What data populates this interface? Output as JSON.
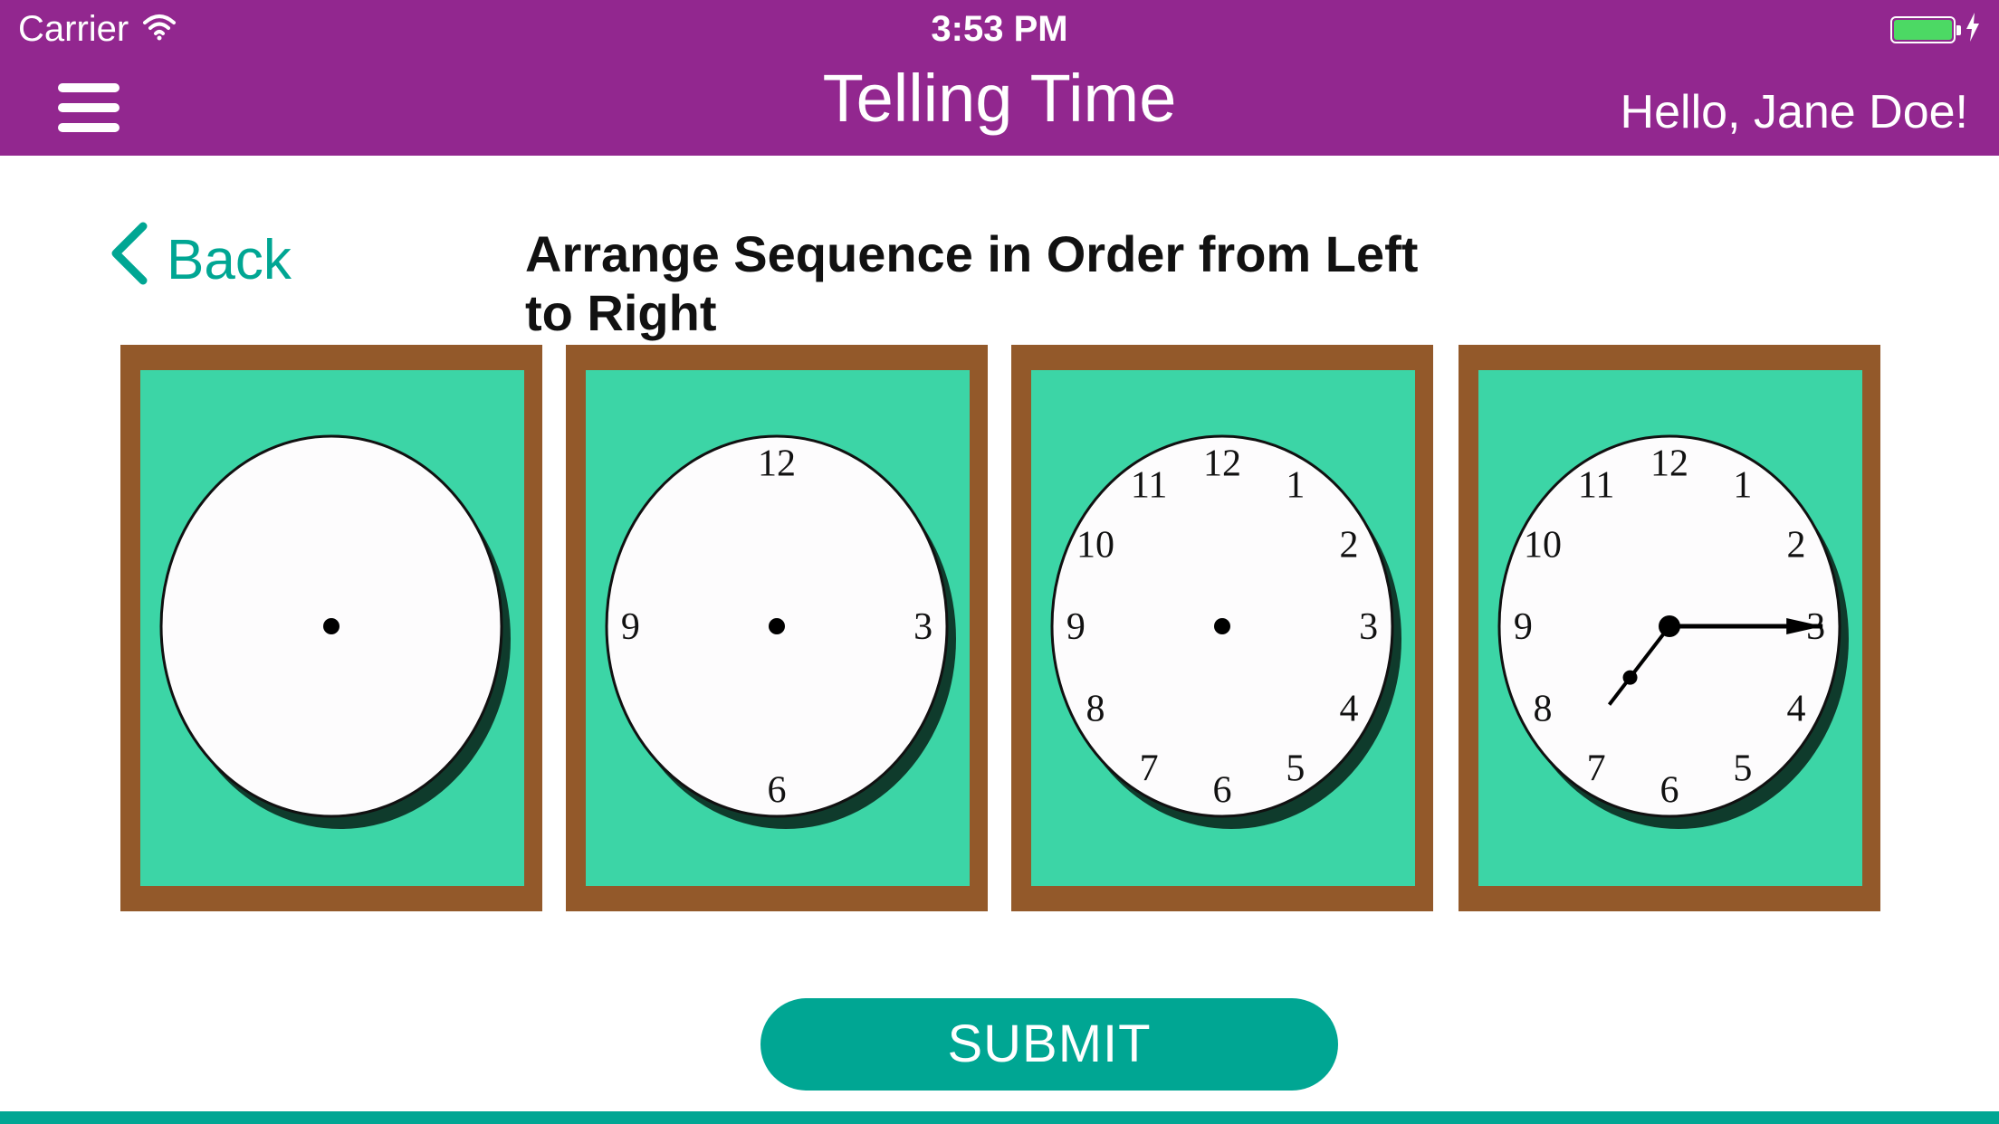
{
  "status_bar": {
    "carrier": "Carrier",
    "time": "3:53 PM",
    "battery_color": "#4cd964"
  },
  "header": {
    "menu_icon": "hamburger-menu-icon",
    "title": "Telling Time",
    "greeting": "Hello, Jane Doe!",
    "background": "#92278f"
  },
  "nav": {
    "back_label": "Back",
    "back_icon": "chevron-left-icon"
  },
  "instruction": "Arrange Sequence in Order from Left to Right",
  "cards": [
    {
      "numerals": []
    },
    {
      "numerals": [
        "12",
        "3",
        "6",
        "9"
      ]
    },
    {
      "numerals": [
        "12",
        "1",
        "2",
        "3",
        "4",
        "5",
        "6",
        "7",
        "8",
        "9",
        "10",
        "11"
      ]
    },
    {
      "numerals": [
        "12",
        "1",
        "2",
        "3",
        "4",
        "5",
        "6",
        "7",
        "8",
        "9",
        "10",
        "11"
      ],
      "hands": {
        "hour": 7,
        "minute": 15
      }
    }
  ],
  "colors": {
    "card_frame": "#93592a",
    "card_background": "#3cd5a6",
    "accent": "#00a693"
  },
  "submit_label": "SUBMIT"
}
